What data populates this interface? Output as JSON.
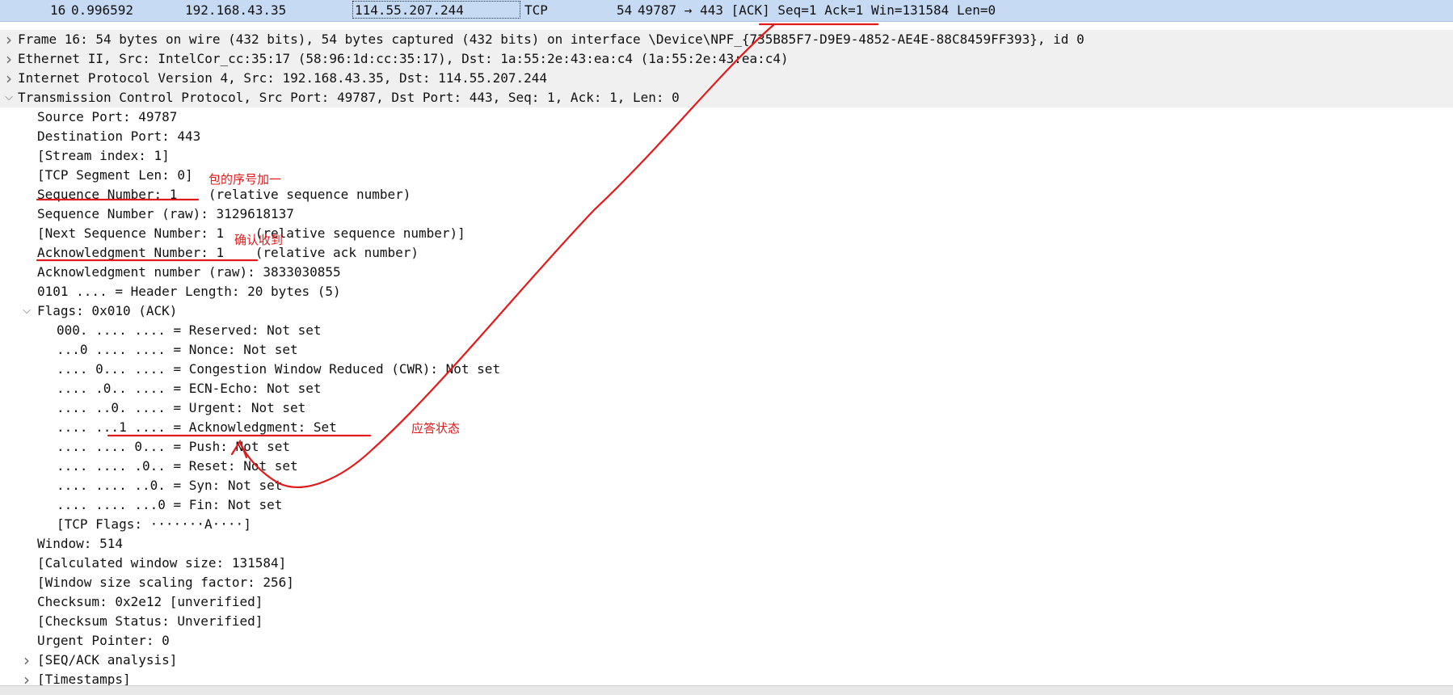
{
  "packet_row": {
    "no": "16",
    "time": "0.996592",
    "source": "192.168.43.35",
    "destination": "114.55.207.244",
    "protocol": "TCP",
    "length": "54",
    "info": "49787 → 443 [ACK] Seq=1 Ack=1 Win=131584 Len=0"
  },
  "tree": [
    {
      "text": "Frame 16: 54 bytes on wire (432 bits), 54 bytes captured (432 bits) on interface \\Device\\NPF_{735B85F7-D9E9-4852-AE4E-88C8459FF393}, id 0",
      "level": 0,
      "expander": "collapsed"
    },
    {
      "text": "Ethernet II, Src: IntelCor_cc:35:17 (58:96:1d:cc:35:17), Dst: 1a:55:2e:43:ea:c4 (1a:55:2e:43:ea:c4)",
      "level": 0,
      "expander": "collapsed"
    },
    {
      "text": "Internet Protocol Version 4, Src: 192.168.43.35, Dst: 114.55.207.244",
      "level": 0,
      "expander": "collapsed"
    },
    {
      "text": "Transmission Control Protocol, Src Port: 49787, Dst Port: 443, Seq: 1, Ack: 1, Len: 0",
      "level": 0,
      "expander": "expanded"
    },
    {
      "text": "Source Port: 49787",
      "level": 1,
      "expander": "none"
    },
    {
      "text": "Destination Port: 443",
      "level": 1,
      "expander": "none"
    },
    {
      "text": "[Stream index: 1]",
      "level": 1,
      "expander": "none"
    },
    {
      "text": "[TCP Segment Len: 0]",
      "level": 1,
      "expander": "none"
    },
    {
      "text": "Sequence Number: 1    (relative sequence number)",
      "level": 1,
      "expander": "none"
    },
    {
      "text": "Sequence Number (raw): 3129618137",
      "level": 1,
      "expander": "none"
    },
    {
      "text": "[Next Sequence Number: 1    (relative sequence number)]",
      "level": 1,
      "expander": "none"
    },
    {
      "text": "Acknowledgment Number: 1    (relative ack number)",
      "level": 1,
      "expander": "none"
    },
    {
      "text": "Acknowledgment number (raw): 3833030855",
      "level": 1,
      "expander": "none"
    },
    {
      "text": "0101 .... = Header Length: 20 bytes (5)",
      "level": 1,
      "expander": "none"
    },
    {
      "text": "Flags: 0x010 (ACK)",
      "level": 1,
      "expander": "expanded"
    },
    {
      "text": "000. .... .... = Reserved: Not set",
      "level": 2,
      "expander": "none"
    },
    {
      "text": "...0 .... .... = Nonce: Not set",
      "level": 2,
      "expander": "none"
    },
    {
      "text": ".... 0... .... = Congestion Window Reduced (CWR): Not set",
      "level": 2,
      "expander": "none"
    },
    {
      "text": ".... .0.. .... = ECN-Echo: Not set",
      "level": 2,
      "expander": "none"
    },
    {
      "text": ".... ..0. .... = Urgent: Not set",
      "level": 2,
      "expander": "none"
    },
    {
      "text": ".... ...1 .... = Acknowledgment: Set",
      "level": 2,
      "expander": "none"
    },
    {
      "text": ".... .... 0... = Push: Not set",
      "level": 2,
      "expander": "none"
    },
    {
      "text": ".... .... .0.. = Reset: Not set",
      "level": 2,
      "expander": "none"
    },
    {
      "text": ".... .... ..0. = Syn: Not set",
      "level": 2,
      "expander": "none"
    },
    {
      "text": ".... .... ...0 = Fin: Not set",
      "level": 2,
      "expander": "none"
    },
    {
      "text": "[TCP Flags: ·······A····]",
      "level": 2,
      "expander": "none"
    },
    {
      "text": "Window: 514",
      "level": 1,
      "expander": "none"
    },
    {
      "text": "[Calculated window size: 131584]",
      "level": 1,
      "expander": "none"
    },
    {
      "text": "[Window size scaling factor: 256]",
      "level": 1,
      "expander": "none"
    },
    {
      "text": "Checksum: 0x2e12 [unverified]",
      "level": 1,
      "expander": "none"
    },
    {
      "text": "[Checksum Status: Unverified]",
      "level": 1,
      "expander": "none"
    },
    {
      "text": "Urgent Pointer: 0",
      "level": 1,
      "expander": "none"
    },
    {
      "text": "[SEQ/ACK analysis]",
      "level": 1,
      "expander": "collapsed"
    },
    {
      "text": "[Timestamps]",
      "level": 1,
      "expander": "collapsed"
    }
  ],
  "annotations": {
    "seq_note": "包的序号加一",
    "ack_note": "确认收到",
    "flag_note": "应答状态"
  },
  "colors": {
    "selected_row": "#c6daf3",
    "annotation_red": "#e11a1a"
  },
  "icons": {
    "collapsed": "chevron-right-icon",
    "expanded": "chevron-down-icon"
  }
}
